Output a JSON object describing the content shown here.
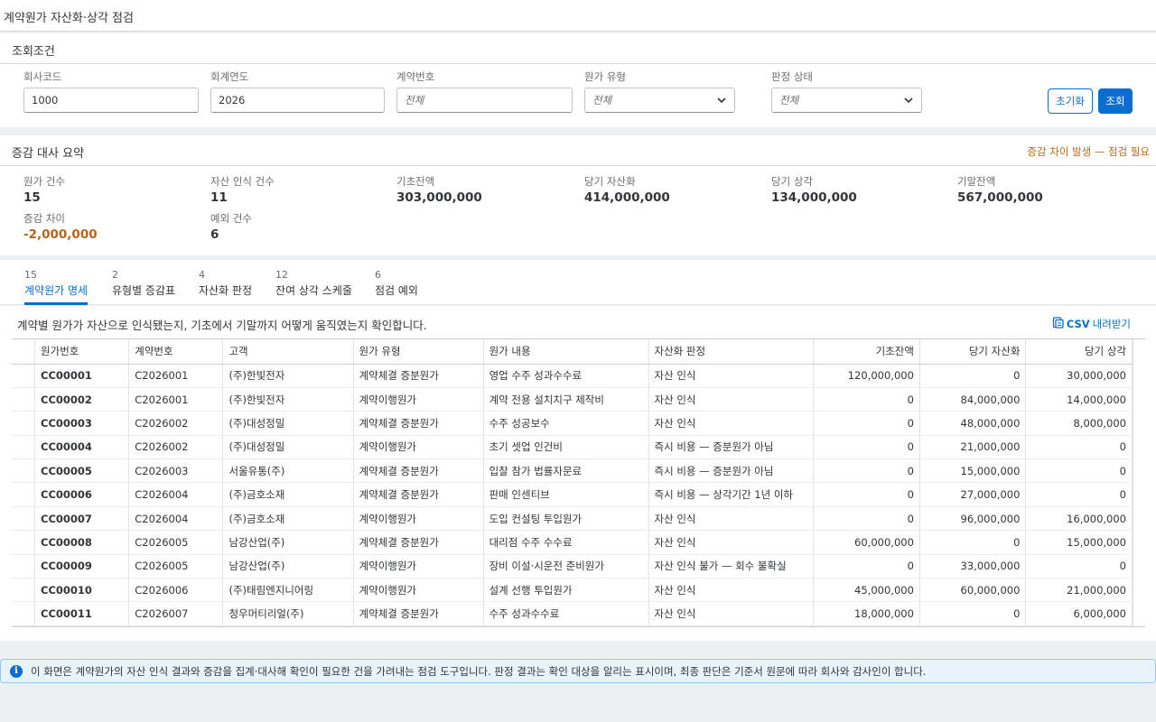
{
  "app": {
    "title": "계약원가 자산화·상각 점검"
  },
  "filter": {
    "title": "조회조건",
    "company_code": {
      "label": "회사코드",
      "value": "1000"
    },
    "fiscal_year": {
      "label": "회계연도",
      "value": "2026"
    },
    "contract_no": {
      "label": "계약번호",
      "placeholder": "전체"
    },
    "cost_type": {
      "label": "원가 유형",
      "value": "전체"
    },
    "judgment_status": {
      "label": "판정 상태",
      "value": "전체"
    },
    "reset_label": "초기화",
    "search_label": "조회"
  },
  "summary": {
    "title": "증감 대사 요약",
    "alert": "증감 차이 발생 — 점검 필요",
    "kpis": [
      {
        "label": "원가 건수",
        "value": "15"
      },
      {
        "label": "자산 인식 건수",
        "value": "11"
      },
      {
        "label": "기초잔액",
        "value": "303,000,000"
      },
      {
        "label": "당기 자산화",
        "value": "414,000,000"
      },
      {
        "label": "당기 상각",
        "value": "134,000,000"
      },
      {
        "label": "기말잔액",
        "value": "567,000,000"
      },
      {
        "label": "증감 차이",
        "value": "-2,000,000"
      },
      {
        "label": "예외 건수",
        "value": "6"
      }
    ]
  },
  "tabs": [
    {
      "count": "15",
      "label": "계약원가 명세"
    },
    {
      "count": "2",
      "label": "유형별 증감표"
    },
    {
      "count": "4",
      "label": "자산화 판정"
    },
    {
      "count": "12",
      "label": "잔여 상각 스케줄"
    },
    {
      "count": "6",
      "label": "점검 예외"
    }
  ],
  "table": {
    "description": "계약별 원가가 자산으로 인식됐는지, 기초에서 기말까지 어떻게 움직였는지 확인합니다.",
    "csv_prefix": "CSV",
    "csv_label": "내려받기",
    "columns": [
      "원가번호",
      "계약번호",
      "고객",
      "원가 유형",
      "원가 내용",
      "자산화 판정",
      "기초잔액",
      "당기 자산화",
      "당기 상각"
    ],
    "rows": [
      [
        "CC00001",
        "C2026001",
        "(주)한빛전자",
        "계약체결 증분원가",
        "영업 수주 성과수수료",
        "자산 인식",
        "120,000,000",
        "0",
        "30,000,000"
      ],
      [
        "CC00002",
        "C2026001",
        "(주)한빛전자",
        "계약이행원가",
        "계약 전용 설치치구 제작비",
        "자산 인식",
        "0",
        "84,000,000",
        "14,000,000"
      ],
      [
        "CC00003",
        "C2026002",
        "(주)대성정밀",
        "계약체결 증분원가",
        "수주 성공보수",
        "자산 인식",
        "0",
        "48,000,000",
        "8,000,000"
      ],
      [
        "CC00004",
        "C2026002",
        "(주)대성정밀",
        "계약이행원가",
        "초기 셋업 인건비",
        "즉시 비용 — 증분원가 아님",
        "0",
        "21,000,000",
        "0"
      ],
      [
        "CC00005",
        "C2026003",
        "서울유통(주)",
        "계약체결 증분원가",
        "입찰 참가 법률자문료",
        "즉시 비용 — 증분원가 아님",
        "0",
        "15,000,000",
        "0"
      ],
      [
        "CC00006",
        "C2026004",
        "(주)금호소재",
        "계약체결 증분원가",
        "판매 인센티브",
        "즉시 비용 — 상각기간 1년 이하",
        "0",
        "27,000,000",
        "0"
      ],
      [
        "CC00007",
        "C2026004",
        "(주)금호소재",
        "계약이행원가",
        "도입 컨설팅 투입원가",
        "자산 인식",
        "0",
        "96,000,000",
        "16,000,000"
      ],
      [
        "CC00008",
        "C2026005",
        "남강산업(주)",
        "계약체결 증분원가",
        "대리점 수주 수수료",
        "자산 인식",
        "60,000,000",
        "0",
        "15,000,000"
      ],
      [
        "CC00009",
        "C2026005",
        "남강산업(주)",
        "계약이행원가",
        "장비 이설·시운전 준비원가",
        "자산 인식 불가 — 회수 불확실",
        "0",
        "33,000,000",
        "0"
      ],
      [
        "CC00010",
        "C2026006",
        "(주)태림엔지니어링",
        "계약이행원가",
        "설계 선행 투입원가",
        "자산 인식",
        "45,000,000",
        "60,000,000",
        "21,000,000"
      ],
      [
        "CC00011",
        "C2026007",
        "청우머티리얼(주)",
        "계약체결 증분원가",
        "수주 성과수수료",
        "자산 인식",
        "18,000,000",
        "0",
        "6,000,000"
      ]
    ]
  },
  "info": {
    "text": "이 화면은 계약원가의 자산 인식 결과와 증감을 집계·대사해 확인이 필요한 건을 가려내는 점검 도구입니다. 판정 결과는 확인 대상을 알리는 표시이며, 최종 판단은 기준서 원문에 따라 회사와 감사인이 합니다."
  },
  "colors": {
    "accent": "#0a6ed1",
    "warning": "#b8651a"
  }
}
